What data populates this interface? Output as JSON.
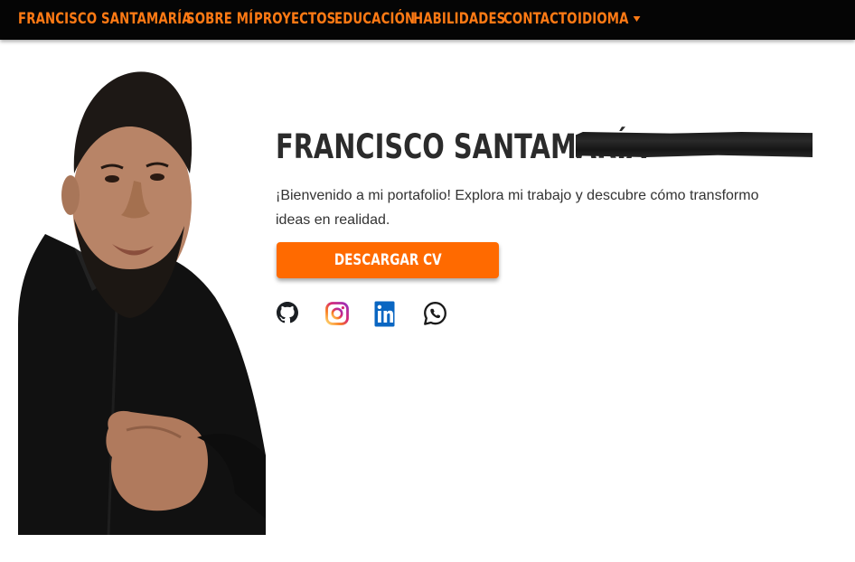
{
  "nav": {
    "brand": "FRANCISCO SANTAMARÍA",
    "items": [
      {
        "label": "SOBRE MÍ"
      },
      {
        "label": "PROYECTOS"
      },
      {
        "label": "EDUCACIÓN"
      },
      {
        "label": "HABILIDADES"
      },
      {
        "label": "CONTACTO"
      },
      {
        "label": "IDIOMA"
      }
    ]
  },
  "hero": {
    "name": "FRANCISCO SANTAMARÍA",
    "description": "¡Bienvenido a mi portafolio! Explora mi trabajo y descubre cómo transformo ideas en realidad.",
    "cv_button": "DESCARGAR CV"
  },
  "social": [
    {
      "icon": "github-icon"
    },
    {
      "icon": "instagram-icon"
    },
    {
      "icon": "linkedin-icon"
    },
    {
      "icon": "whatsapp-icon"
    }
  ],
  "colors": {
    "accent": "#ff6a00",
    "nav_text": "#ff7a14",
    "nav_bg": "#050505",
    "heading": "#2b2b2b",
    "linkedin": "#0a66c2"
  }
}
